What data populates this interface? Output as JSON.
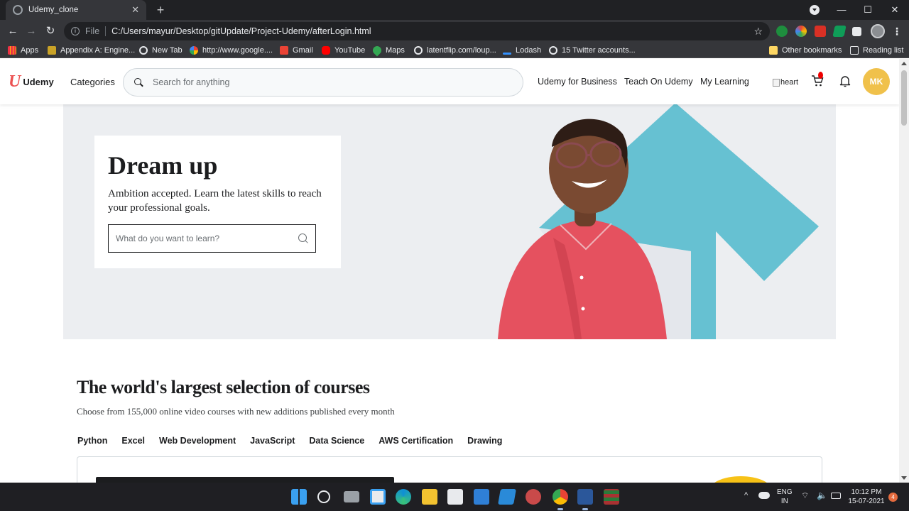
{
  "browser": {
    "tab_title": "Udemy_clone",
    "tab_close": "✕",
    "new_tab": "+",
    "scheme": "File",
    "url": "C:/Users/mayur/Desktop/gitUpdate/Project-Udemy/afterLogin.html",
    "window_minimize": "—",
    "window_maximize": "☐",
    "window_close": "✕"
  },
  "bookmarks": {
    "apps": "Apps",
    "items": [
      {
        "label": "Appendix A: Engine...",
        "icon": "book-icon",
        "color": "#c9a227"
      },
      {
        "label": "New Tab",
        "icon": "globe-icon"
      },
      {
        "label": "http://www.google....",
        "icon": "google-icon"
      },
      {
        "label": "Gmail",
        "icon": "gmail-icon",
        "color": "#ea4335"
      },
      {
        "label": "YouTube",
        "icon": "youtube-icon",
        "color": "#ff0000"
      },
      {
        "label": "Maps",
        "icon": "maps-icon",
        "color": "#34a853"
      },
      {
        "label": "latentflip.com/loup...",
        "icon": "globe-icon"
      },
      {
        "label": "Lodash",
        "icon": "lodash-icon",
        "color": "#3492ff"
      },
      {
        "label": "15 Twitter accounts...",
        "icon": "globe-icon"
      }
    ],
    "other": "Other bookmarks",
    "reading_list": "Reading list"
  },
  "header": {
    "logo_mark": "U",
    "logo_text": "Udemy",
    "categories": "Categories",
    "search_placeholder": "Search for anything",
    "links": [
      "Udemy for Business",
      "Teach On Udemy",
      "My Learning"
    ],
    "heart_alt": "heart",
    "avatar_initials": "MK"
  },
  "hero": {
    "title": "Dream up",
    "subtitle": "Ambition accepted. Learn the latest skills to reach your professional goals.",
    "search_placeholder": "What do you want to learn?"
  },
  "courses": {
    "title": "The world's largest selection of courses",
    "subtitle": "Choose from 155,000 online video courses with new additions published every month",
    "tabs": [
      "Python",
      "Excel",
      "Web Development",
      "JavaScript",
      "Data Science",
      "AWS Certification",
      "Drawing"
    ]
  },
  "taskbar": {
    "lang_top": "ENG",
    "lang_bottom": "IN",
    "time": "10:12 PM",
    "date": "15-07-2021",
    "notifications": "4"
  },
  "colors": {
    "brand_red": "#ec5252",
    "avatar_bg": "#f0c14b",
    "hero_bg": "#eceef1",
    "arrow_teal": "#66c1d2",
    "shirt_red": "#e5515f"
  }
}
